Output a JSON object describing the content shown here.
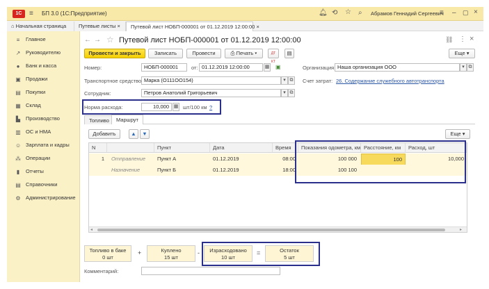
{
  "app": {
    "title": "БП 3.0  (1С:Предприятие)",
    "user": "Абрамов Геннадий Сергеевич"
  },
  "tabs": [
    {
      "label": "Начальная страница"
    },
    {
      "label": "Путевые листы"
    },
    {
      "label": "Путевой лист НОБП-000001 от 01.12.2019 12:00:00"
    }
  ],
  "sidebar": {
    "items": [
      {
        "label": "Главное",
        "icon": "menu-icon"
      },
      {
        "label": "Руководителю",
        "icon": "chart-icon"
      },
      {
        "label": "Банк и касса",
        "icon": "bank-icon"
      },
      {
        "label": "Продажи",
        "icon": "cart-icon"
      },
      {
        "label": "Покупки",
        "icon": "basket-icon"
      },
      {
        "label": "Склад",
        "icon": "warehouse-icon"
      },
      {
        "label": "Производство",
        "icon": "factory-icon"
      },
      {
        "label": "ОС и НМА",
        "icon": "assets-icon"
      },
      {
        "label": "Зарплата и кадры",
        "icon": "people-icon"
      },
      {
        "label": "Операции",
        "icon": "operations-icon"
      },
      {
        "label": "Отчеты",
        "icon": "reports-icon"
      },
      {
        "label": "Справочники",
        "icon": "catalog-icon"
      },
      {
        "label": "Администрирование",
        "icon": "gear-icon"
      }
    ]
  },
  "document": {
    "title": "Путевой лист НОБП-000001 от 01.12.2019 12:00:00",
    "toolbar": {
      "post_close": "Провести и закрыть",
      "save": "Записать",
      "post": "Провести",
      "print": "Печать",
      "more": "Еще"
    },
    "fields": {
      "number_label": "Номер:",
      "number": "НОБП-000001",
      "date_label": "от:",
      "date": "01.12.2019 12:00:00",
      "vehicle_label": "Транспортное средство:",
      "vehicle": "Марка (О111ОО154)",
      "employee_label": "Сотрудник:",
      "employee": "Петров Анатолий Григорьевич",
      "rate_label": "Норма расхода:",
      "rate": "10,000",
      "rate_unit": "шт/100 км",
      "rate_help": "?",
      "org_label": "Организация:",
      "org": "Наша организация ООО",
      "cost_label": "Счет затрат:",
      "cost": "26. Содержание служебного автотранспорта"
    },
    "inner_tabs": [
      {
        "label": "Топливо"
      },
      {
        "label": "Маршрут"
      }
    ],
    "grid_toolbar": {
      "add": "Добавить",
      "more": "Еще"
    },
    "grid": {
      "headers": [
        "N",
        "",
        "Пункт",
        "Дата",
        "Время",
        "Показания одометра, км",
        "Расстояние, км",
        "Расход, шт"
      ],
      "rows": [
        {
          "n": "1",
          "kind": "Отправление",
          "point": "Пункт А",
          "date": "01.12.2019",
          "time": "08:00",
          "odometer": "100 000",
          "distance": "100",
          "consumption": "10,000"
        },
        {
          "n": "",
          "kind": "Назначение",
          "point": "Пункт Б",
          "date": "01.12.2019",
          "time": "18:00",
          "odometer": "100 100",
          "distance": "",
          "consumption": ""
        }
      ]
    },
    "totals": {
      "fuel_in_tank": "Топливо в баке",
      "fuel_in_tank_value": "0 шт",
      "plus": "+",
      "bought": "Куплено",
      "bought_value": "15 шт",
      "minus": "-",
      "spent": "Израсходовано",
      "spent_value": "10 шт",
      "equals": "=",
      "rest": "Остаток",
      "rest_value": "5 шт"
    },
    "comment_label": "Комментарий:"
  }
}
